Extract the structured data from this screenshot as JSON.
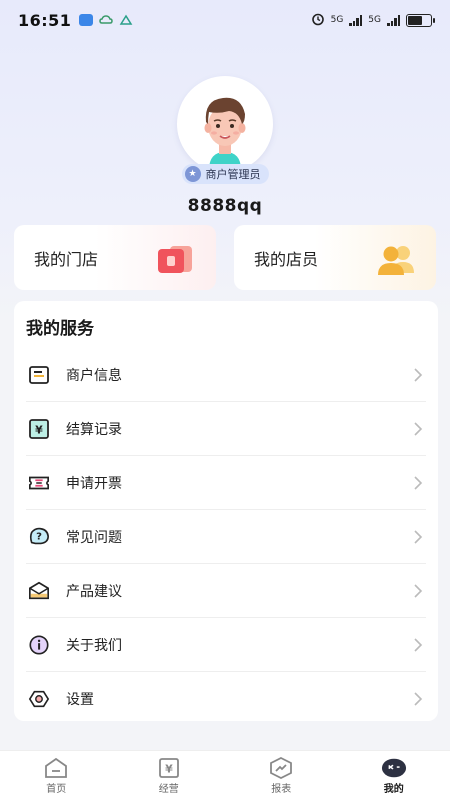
{
  "status_bar": {
    "time": "16:51",
    "network_1": "5G",
    "network_2": "5G",
    "battery_level": 0.65
  },
  "profile": {
    "role": "商户管理员",
    "username": "8888qq"
  },
  "cards": [
    {
      "label": "我的门店",
      "icon": "store-icon",
      "accent": "#f0535c"
    },
    {
      "label": "我的店员",
      "icon": "staff-icon",
      "accent": "#f3b23a"
    }
  ],
  "services": {
    "title": "我的服务",
    "items": [
      {
        "label": "商户信息",
        "icon": "merchant-info-icon"
      },
      {
        "label": "结算记录",
        "icon": "settlement-icon"
      },
      {
        "label": "申请开票",
        "icon": "invoice-icon"
      },
      {
        "label": "常见问题",
        "icon": "faq-icon"
      },
      {
        "label": "产品建议",
        "icon": "suggestion-icon"
      },
      {
        "label": "关于我们",
        "icon": "about-icon"
      },
      {
        "label": "设置",
        "icon": "settings-icon"
      }
    ]
  },
  "tabbar": {
    "tabs": [
      {
        "label": "首页",
        "icon": "home-icon",
        "active": false
      },
      {
        "label": "经营",
        "icon": "business-icon",
        "active": false
      },
      {
        "label": "报表",
        "icon": "report-icon",
        "active": false
      },
      {
        "label": "我的",
        "icon": "mine-icon",
        "active": true
      }
    ]
  },
  "colors": {
    "background": "#f3f4f8",
    "header_gradient": "#e7eafb",
    "badge_bg": "#d9e3fb",
    "active_tab": "#2d3142"
  }
}
